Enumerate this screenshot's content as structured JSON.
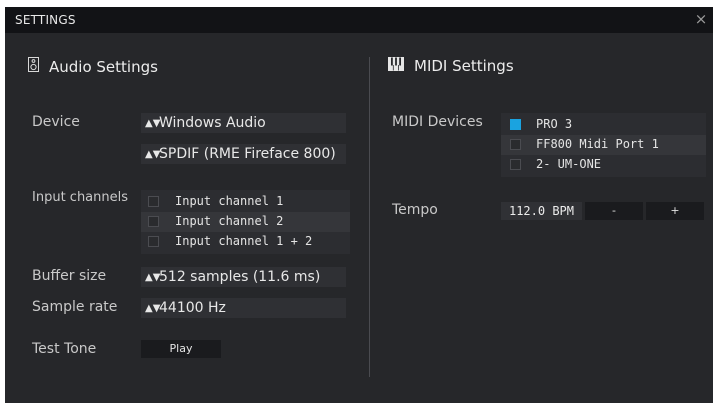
{
  "window": {
    "title": "SETTINGS",
    "close_glyph": "×"
  },
  "audio": {
    "heading": "Audio Settings",
    "icon": "speaker-icon",
    "device": {
      "label": "Device",
      "driver": "Windows Audio",
      "interface": "SPDIF (RME Fireface 800)"
    },
    "input_channels": {
      "label": "Input channels",
      "items": [
        {
          "label": "Input channel 1",
          "checked": false
        },
        {
          "label": "Input channel 2",
          "checked": false
        },
        {
          "label": "Input channel 1 + 2",
          "checked": false
        }
      ]
    },
    "buffer_size": {
      "label": "Buffer size",
      "value": "512 samples (11.6 ms)"
    },
    "sample_rate": {
      "label": "Sample rate",
      "value": "44100 Hz"
    },
    "test_tone": {
      "label": "Test Tone",
      "button": "Play"
    }
  },
  "midi": {
    "heading": "MIDI Settings",
    "icon": "piano-keys-icon",
    "devices": {
      "label": "MIDI Devices",
      "items": [
        {
          "label": "PRO 3",
          "checked": true
        },
        {
          "label": "FF800 Midi Port 1",
          "checked": false
        },
        {
          "label": "2- UM-ONE",
          "checked": false
        }
      ]
    },
    "tempo": {
      "label": "Tempo",
      "value": "112.0 BPM",
      "decrement": "-",
      "increment": "+"
    }
  },
  "colors": {
    "accent": "#1aa3e0",
    "panel": "#26272a",
    "titlebar": "#121316"
  }
}
